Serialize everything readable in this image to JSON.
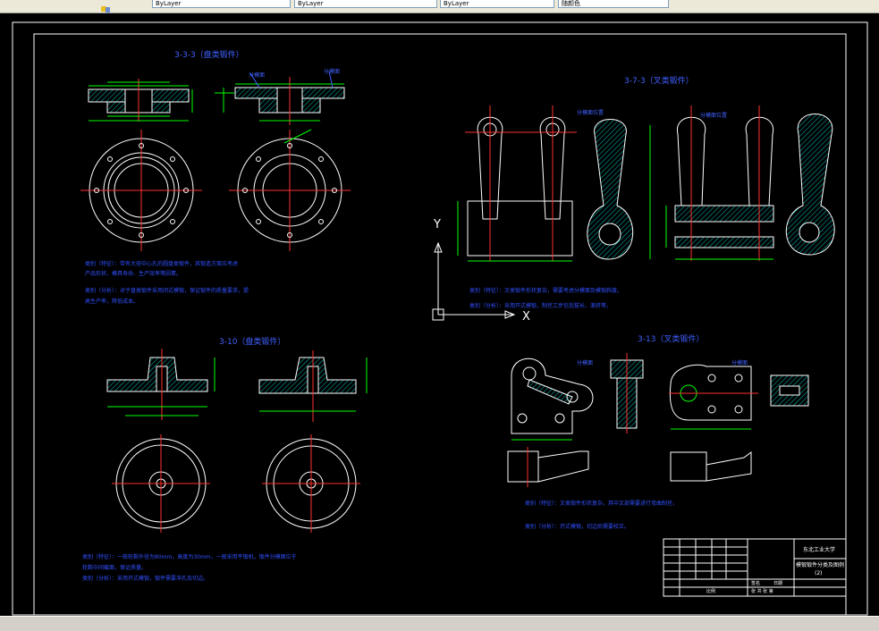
{
  "toolbar": {
    "fields": [
      "ByLayer",
      "ByLayer",
      "ByLayer",
      "随颜色"
    ]
  },
  "drawing": {
    "titles": {
      "t1": "3-3-3（盘类锻件）",
      "t2": "3-7-3（叉类锻件）",
      "t3": "3-10（盘类锻件）",
      "t4": "3-13（叉类锻件）"
    },
    "notes": {
      "n1a": "类别（特征）：带有大径中心孔的圆盘类锻件，其锻造方案应考虑",
      "n1b": "产品形状、模具寿命、生产效率等因素。",
      "n1c": "类别（分析）：对于盘类锻件采用闭式模锻，保证锻件的质量要求，提",
      "n1d": "高生产率，降低成本。",
      "n2a": "类别（特征）：叉类锻件形状复杂，需要考虑分模面及模锻斜度。",
      "n2b": "类别（分析）：采用开式模锻，制坯工步包括拔长、滚挤等，",
      "n3a": "类别（特征）：一般轮毂外径为80mm，高度为30mm，一般采用平锻机，锻件分模面位于",
      "n3b": "轮毂中间截面，保证质量。",
      "n3c": "类别（分析）：采用开式模锻，锻件需要冲孔及切边。",
      "n4a": "类别（特征）：叉类锻件形状复杂，其中叉部需要进行弯曲制坯，",
      "n4b": "类别（分析）：开式模锻，切边后需要校正。"
    },
    "labels": {
      "a1": "分模面",
      "a2": "分模面",
      "a3": "分模面位置",
      "a4": "分模面位置",
      "a5": "分模面",
      "a6": "分模面"
    },
    "titleblock": {
      "school": "东北工业大学",
      "name": "模锻锻件分类及图例",
      "sheet": "(2)",
      "label1": "签名",
      "label2": "日期",
      "label3": "比例",
      "label4": "张 共 张 第"
    },
    "ucs": {
      "y": "Y",
      "x": "X"
    }
  },
  "colors": {
    "background": "#000000",
    "line": "#ffffff",
    "dimension": "#00ff00",
    "center": "#ff0000",
    "note": "#0000ff",
    "hatch": "#00bfbf"
  }
}
